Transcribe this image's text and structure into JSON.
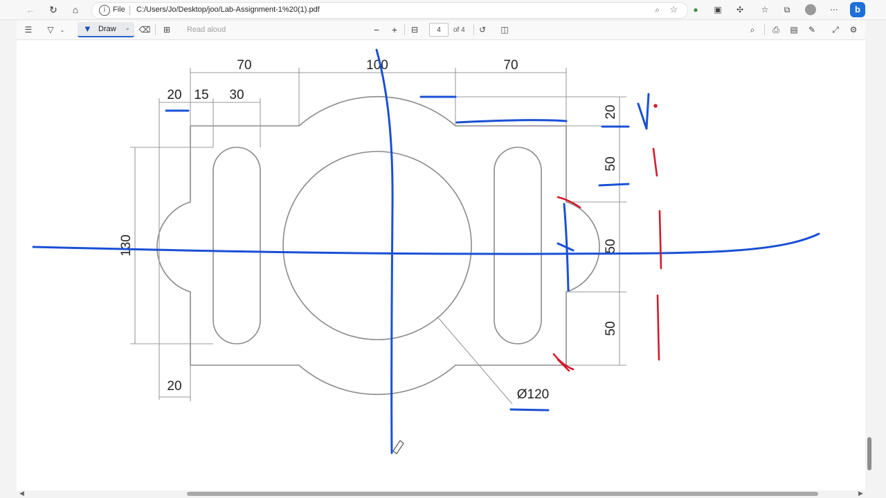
{
  "browser": {
    "file_label": "File",
    "url": "C:/Users/Jo/Desktop/joo/Lab-Assignment-1%20(1).pdf"
  },
  "pdf_toolbar": {
    "draw_label": "Draw",
    "read_aloud_label": "Read aloud",
    "page_current": "4",
    "page_total": "of 4"
  },
  "drawing": {
    "dims_top": [
      "70",
      "100",
      "70"
    ],
    "dims_left_top": [
      "20",
      "15",
      "30"
    ],
    "dim_left_height": "130",
    "dim_bottom_left": "20",
    "dims_right": [
      "20",
      "50",
      "50",
      "50"
    ],
    "diameter_label": "Ø120"
  },
  "colors": {
    "ink_blue": "#1a4fd6",
    "ink_red": "#d4192c",
    "accent": "#2563c9"
  }
}
